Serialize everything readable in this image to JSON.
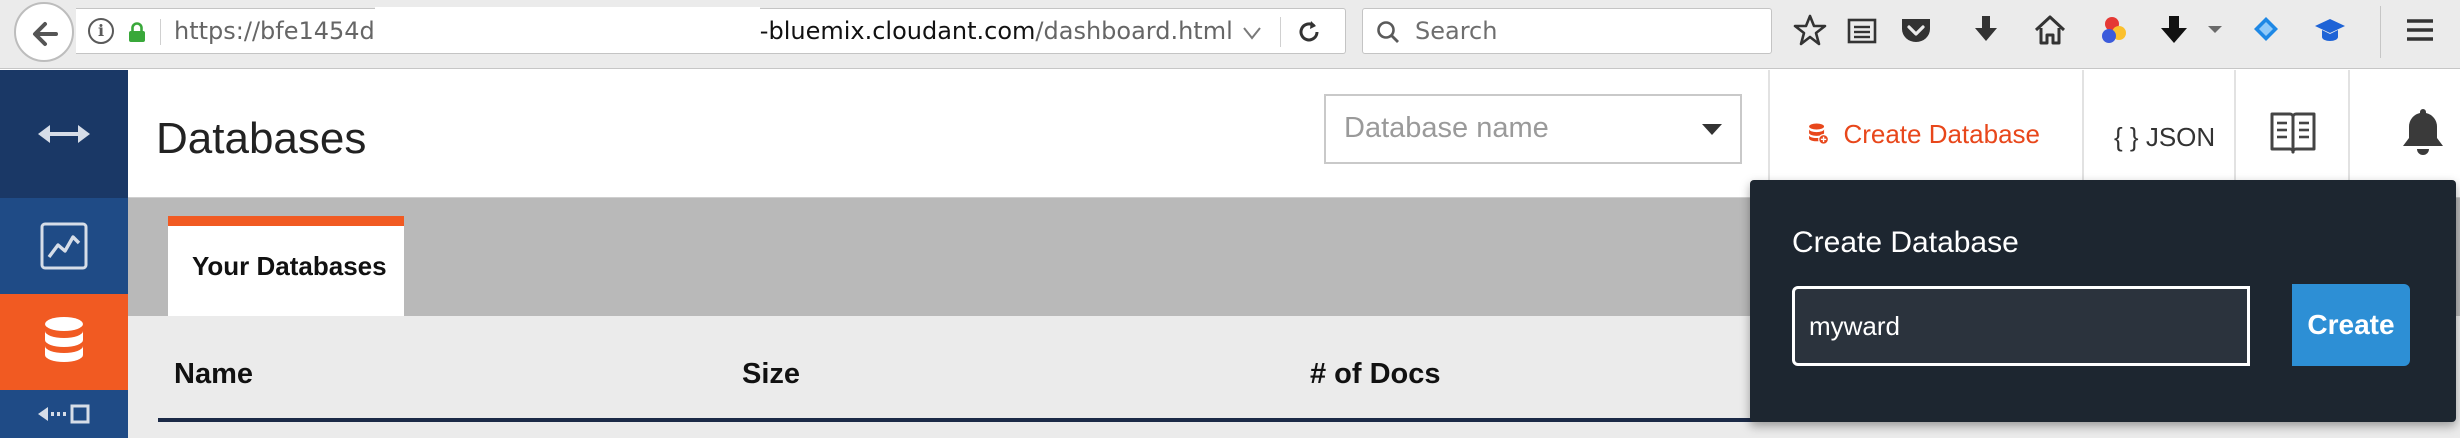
{
  "browser": {
    "url_prefix": "https://bfe1454d",
    "url_host": "-bluemix.cloudant.com",
    "url_path": "/dashboard.html",
    "search_placeholder": "Search",
    "toolbar_icons": [
      "star-icon",
      "reading-list-icon",
      "pocket-icon",
      "download-icon",
      "home-icon",
      "extension-icon",
      "download-arrow-icon",
      "overflow-icon",
      "extension-icon",
      "extension-icon",
      "menu-icon"
    ]
  },
  "sidebar": {
    "items": [
      {
        "icon": "arrows-icon"
      },
      {
        "icon": "activity-chart-icon"
      },
      {
        "icon": "database-icon",
        "active": true
      },
      {
        "icon": "replication-icon"
      }
    ]
  },
  "header": {
    "title": "Databases",
    "db_select_placeholder": "Database name",
    "create_db_label": "Create Database",
    "json_label": "{ } JSON"
  },
  "tabs": [
    {
      "label": "Your Databases",
      "active": true
    }
  ],
  "table": {
    "columns": [
      "Name",
      "Size",
      "# of Docs"
    ]
  },
  "popover": {
    "title": "Create Database",
    "input_value": "myward",
    "create_label": "Create"
  },
  "colors": {
    "accent_orange": "#f15a22",
    "sidebar_blue": "#1b3c6c",
    "popover_bg": "#1d2630",
    "create_button_blue": "#2d8fd5"
  }
}
